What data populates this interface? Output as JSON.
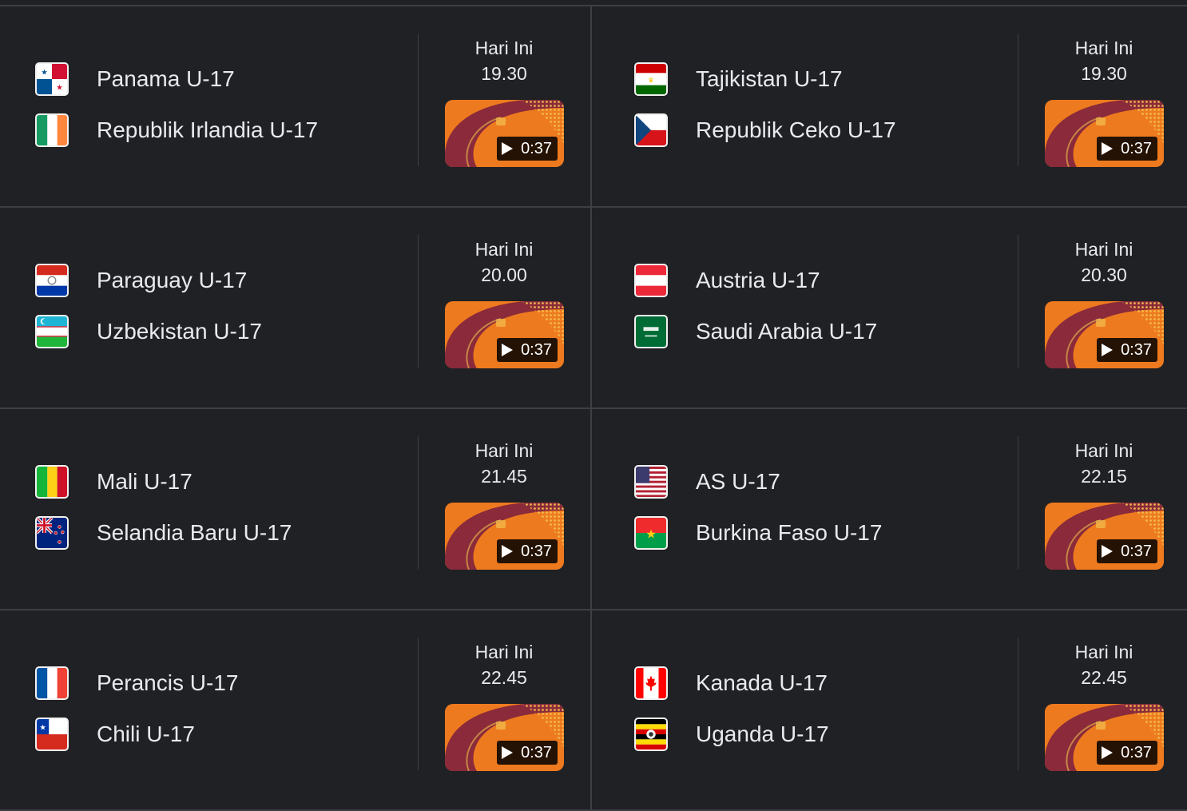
{
  "matches": [
    {
      "home": "Panama U-17",
      "away": "Republik Irlandia U-17",
      "day": "Hari Ini",
      "time": "19.30",
      "duration": "0:37",
      "home_flag": "panama-flag-icon",
      "away_flag": "ireland-flag-icon"
    },
    {
      "home": "Tajikistan U-17",
      "away": "Republik Ceko U-17",
      "day": "Hari Ini",
      "time": "19.30",
      "duration": "0:37",
      "home_flag": "tajikistan-flag-icon",
      "away_flag": "czech-flag-icon"
    },
    {
      "home": "Paraguay U-17",
      "away": "Uzbekistan U-17",
      "day": "Hari Ini",
      "time": "20.00",
      "duration": "0:37",
      "home_flag": "paraguay-flag-icon",
      "away_flag": "uzbekistan-flag-icon"
    },
    {
      "home": "Austria U-17",
      "away": "Saudi Arabia U-17",
      "day": "Hari Ini",
      "time": "20.30",
      "duration": "0:37",
      "home_flag": "austria-flag-icon",
      "away_flag": "saudi-arabia-flag-icon"
    },
    {
      "home": "Mali U-17",
      "away": "Selandia Baru U-17",
      "day": "Hari Ini",
      "time": "21.45",
      "duration": "0:37",
      "home_flag": "mali-flag-icon",
      "away_flag": "new-zealand-flag-icon"
    },
    {
      "home": "AS U-17",
      "away": "Burkina Faso U-17",
      "day": "Hari Ini",
      "time": "22.15",
      "duration": "0:37",
      "home_flag": "usa-flag-icon",
      "away_flag": "burkina-faso-flag-icon"
    },
    {
      "home": "Perancis U-17",
      "away": "Chili U-17",
      "day": "Hari Ini",
      "time": "22.45",
      "duration": "0:37",
      "home_flag": "france-flag-icon",
      "away_flag": "chile-flag-icon"
    },
    {
      "home": "Kanada U-17",
      "away": "Uganda U-17",
      "day": "Hari Ini",
      "time": "22.45",
      "duration": "0:37",
      "home_flag": "canada-flag-icon",
      "away_flag": "uganda-flag-icon"
    }
  ],
  "colors": {
    "background": "#202124",
    "divider": "#3c4043",
    "text": "#e8eaed",
    "thumb_orange": "#ee7a1f",
    "thumb_maroon": "#8a2a3a"
  }
}
